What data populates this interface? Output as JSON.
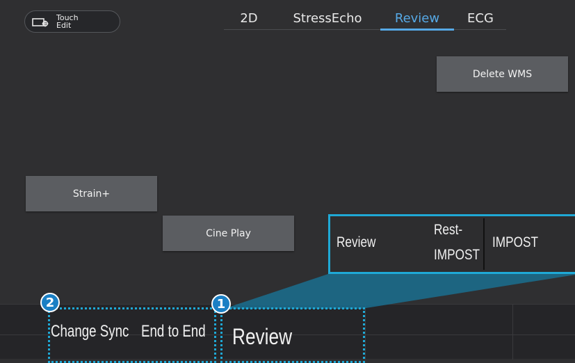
{
  "touch_edit": {
    "label_line1": "Touch",
    "label_line2": "Edit",
    "icon": "touch-edit-icon"
  },
  "mode_tabs": [
    {
      "label": "2D",
      "active": false
    },
    {
      "label": "StressEcho",
      "active": false
    },
    {
      "label": "Review",
      "active": true
    },
    {
      "label": "ECG",
      "active": false
    }
  ],
  "buttons": {
    "delete_wms": "Delete WMS",
    "strain_plus": "Strain+",
    "cine_play": "Cine Play"
  },
  "callout": {
    "col1": "Review",
    "col2_line1": "Rest-",
    "col2_line2": "IMPOST",
    "col3": "IMPOST"
  },
  "bottom_bar": {
    "change_sync": "Change Sync",
    "end_to_end": "End to End",
    "review": "Review"
  },
  "badges": {
    "one": "1",
    "two": "2"
  },
  "colors": {
    "accent": "#56a9e6",
    "callout": "#1fa9d6",
    "badge": "#1a7fc4",
    "button": "#5b5d61",
    "background": "#2f2f31"
  }
}
